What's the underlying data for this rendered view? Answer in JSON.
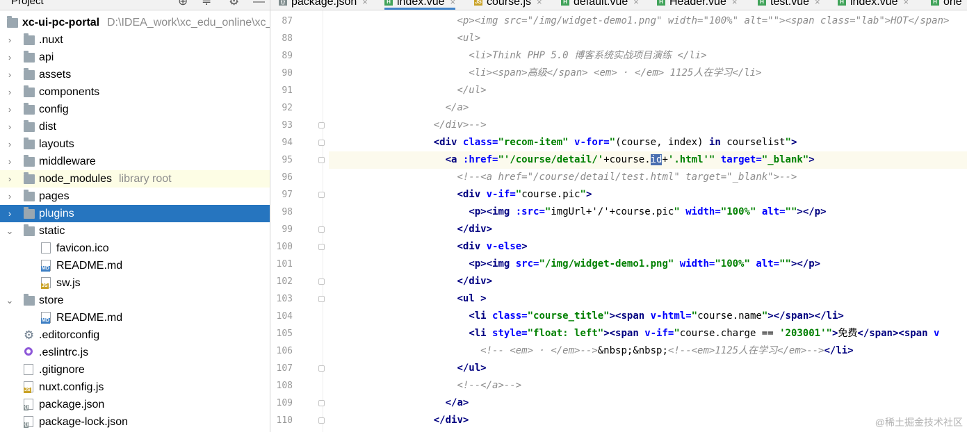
{
  "project_pane": {
    "title": "Project",
    "root": {
      "name": "xc-ui-pc-portal",
      "path": "D:\\IDEA_work\\xc_edu_online\\xc_"
    },
    "items": [
      {
        "name": ".nuxt",
        "type": "folder",
        "level": 1,
        "expanded": false
      },
      {
        "name": "api",
        "type": "folder",
        "level": 1,
        "expanded": false
      },
      {
        "name": "assets",
        "type": "folder",
        "level": 1,
        "expanded": false
      },
      {
        "name": "components",
        "type": "folder",
        "level": 1,
        "expanded": false
      },
      {
        "name": "config",
        "type": "folder",
        "level": 1,
        "expanded": false
      },
      {
        "name": "dist",
        "type": "folder",
        "level": 1,
        "expanded": false
      },
      {
        "name": "layouts",
        "type": "folder",
        "level": 1,
        "expanded": false
      },
      {
        "name": "middleware",
        "type": "folder",
        "level": 1,
        "expanded": false
      },
      {
        "name": "node_modules",
        "suffix": "library root",
        "type": "folder",
        "level": 1,
        "expanded": false,
        "highlighted": true
      },
      {
        "name": "pages",
        "type": "folder",
        "level": 1,
        "expanded": false
      },
      {
        "name": "plugins",
        "type": "folder",
        "level": 1,
        "expanded": false,
        "selected": true
      },
      {
        "name": "static",
        "type": "folder",
        "level": 1,
        "expanded": true
      },
      {
        "name": "favicon.ico",
        "type": "file",
        "icon": "ico",
        "level": 2
      },
      {
        "name": "README.md",
        "type": "file",
        "icon": "md",
        "level": 2
      },
      {
        "name": "sw.js",
        "type": "file",
        "icon": "js",
        "level": 2
      },
      {
        "name": "store",
        "type": "folder",
        "level": 1,
        "expanded": true
      },
      {
        "name": "README.md",
        "type": "file",
        "icon": "md",
        "level": 2
      },
      {
        "name": ".editorconfig",
        "type": "file",
        "icon": "gear",
        "level": 1
      },
      {
        "name": ".eslintrc.js",
        "type": "file",
        "icon": "eslint",
        "level": 1
      },
      {
        "name": ".gitignore",
        "type": "file",
        "icon": "txt",
        "level": 1
      },
      {
        "name": "nuxt.config.js",
        "type": "file",
        "icon": "js",
        "level": 1
      },
      {
        "name": "package.json",
        "type": "file",
        "icon": "json",
        "level": 1
      },
      {
        "name": "package-lock.json",
        "type": "file",
        "icon": "json",
        "level": 1
      }
    ]
  },
  "tabs": [
    {
      "label": "package.json",
      "icon": "json",
      "active": false
    },
    {
      "label": "index.vue",
      "icon": "vue",
      "active": true
    },
    {
      "label": "course.js",
      "icon": "js",
      "active": false
    },
    {
      "label": "default.vue",
      "icon": "vue",
      "active": false
    },
    {
      "label": "Header.vue",
      "icon": "vue",
      "active": false
    },
    {
      "label": "test.vue",
      "icon": "vue",
      "active": false
    },
    {
      "label": "index.vue",
      "icon": "vue",
      "active": false
    },
    {
      "label": "one",
      "icon": "vue",
      "active": false
    }
  ],
  "editor": {
    "current_line": 95,
    "lines": [
      {
        "n": 87,
        "fold": false,
        "indent": 22,
        "tokens": [
          {
            "t": "cm",
            "v": "<p><img src=\"/img/widget-demo1.png\" width=\"100%\" alt=\"\"><span class=\"lab\">HOT</span>"
          }
        ]
      },
      {
        "n": 88,
        "fold": false,
        "indent": 22,
        "tokens": [
          {
            "t": "cm",
            "v": "<ul>"
          }
        ]
      },
      {
        "n": 89,
        "fold": false,
        "indent": 24,
        "tokens": [
          {
            "t": "cm",
            "v": "<li>Think PHP 5.0 博客系统实战项目演练 </li>"
          }
        ]
      },
      {
        "n": 90,
        "fold": false,
        "indent": 24,
        "tokens": [
          {
            "t": "cm",
            "v": "<li><span>高级</span> <em> · </em> 1125人在学习</li>"
          }
        ]
      },
      {
        "n": 91,
        "fold": false,
        "indent": 22,
        "tokens": [
          {
            "t": "cm",
            "v": "</ul>"
          }
        ]
      },
      {
        "n": 92,
        "fold": false,
        "indent": 20,
        "tokens": [
          {
            "t": "cm",
            "v": "</a>"
          }
        ]
      },
      {
        "n": 93,
        "fold": true,
        "indent": 18,
        "tokens": [
          {
            "t": "cm",
            "v": "</div>-->"
          }
        ]
      },
      {
        "n": 94,
        "fold": true,
        "indent": 18,
        "tokens": [
          {
            "t": "tg",
            "v": "<div "
          },
          {
            "t": "at",
            "v": "class="
          },
          {
            "t": "st",
            "v": "\"recom-item\" "
          },
          {
            "t": "at",
            "v": "v-for="
          },
          {
            "t": "st",
            "v": "\""
          },
          {
            "t": "ex",
            "v": "(course, index) "
          },
          {
            "t": "kw",
            "v": "in"
          },
          {
            "t": "ex",
            "v": " courselist"
          },
          {
            "t": "st",
            "v": "\""
          },
          {
            "t": "tg",
            "v": ">"
          }
        ]
      },
      {
        "n": 95,
        "fold": true,
        "indent": 20,
        "tokens": [
          {
            "t": "tg",
            "v": "<a "
          },
          {
            "t": "at",
            "v": ":href="
          },
          {
            "t": "st",
            "v": "\"'/course/detail/'"
          },
          {
            "t": "ex",
            "v": "+course."
          },
          {
            "t": "sel",
            "v": "id"
          },
          {
            "t": "ex",
            "v": "+"
          },
          {
            "t": "st",
            "v": "'.html'\" "
          },
          {
            "t": "at",
            "v": "target="
          },
          {
            "t": "st",
            "v": "\"_blank\""
          },
          {
            "t": "tg",
            "v": ">"
          }
        ]
      },
      {
        "n": 96,
        "fold": false,
        "indent": 22,
        "tokens": [
          {
            "t": "cm",
            "v": "<!--<a href=\"/course/detail/test.html\" target=\"_blank\">-->"
          }
        ]
      },
      {
        "n": 97,
        "fold": true,
        "indent": 22,
        "tokens": [
          {
            "t": "tg",
            "v": "<div "
          },
          {
            "t": "at",
            "v": "v-if="
          },
          {
            "t": "st",
            "v": "\""
          },
          {
            "t": "ex",
            "v": "course.pic"
          },
          {
            "t": "st",
            "v": "\""
          },
          {
            "t": "tg",
            "v": ">"
          }
        ]
      },
      {
        "n": 98,
        "fold": false,
        "indent": 24,
        "tokens": [
          {
            "t": "tg",
            "v": "<p><img "
          },
          {
            "t": "at",
            "v": ":src="
          },
          {
            "t": "st",
            "v": "\""
          },
          {
            "t": "ex",
            "v": "imgUrl+'/'+course.pic"
          },
          {
            "t": "st",
            "v": "\" "
          },
          {
            "t": "at",
            "v": "width="
          },
          {
            "t": "st",
            "v": "\"100%\" "
          },
          {
            "t": "at",
            "v": "alt="
          },
          {
            "t": "st",
            "v": "\"\""
          },
          {
            "t": "tg",
            "v": "></p>"
          }
        ]
      },
      {
        "n": 99,
        "fold": true,
        "indent": 22,
        "tokens": [
          {
            "t": "tg",
            "v": "</div>"
          }
        ]
      },
      {
        "n": 100,
        "fold": true,
        "indent": 22,
        "tokens": [
          {
            "t": "tg",
            "v": "<div "
          },
          {
            "t": "at",
            "v": "v-else"
          },
          {
            "t": "tg",
            "v": ">"
          }
        ]
      },
      {
        "n": 101,
        "fold": false,
        "indent": 24,
        "tokens": [
          {
            "t": "tg",
            "v": "<p><img "
          },
          {
            "t": "at",
            "v": "src="
          },
          {
            "t": "st",
            "v": "\"/img/widget-demo1.png\" "
          },
          {
            "t": "at",
            "v": "width="
          },
          {
            "t": "st",
            "v": "\"100%\" "
          },
          {
            "t": "at",
            "v": "alt="
          },
          {
            "t": "st",
            "v": "\"\""
          },
          {
            "t": "tg",
            "v": "></p>"
          }
        ]
      },
      {
        "n": 102,
        "fold": true,
        "indent": 22,
        "tokens": [
          {
            "t": "tg",
            "v": "</div>"
          }
        ]
      },
      {
        "n": 103,
        "fold": true,
        "indent": 22,
        "tokens": [
          {
            "t": "tg",
            "v": "<ul >"
          }
        ]
      },
      {
        "n": 104,
        "fold": false,
        "indent": 24,
        "tokens": [
          {
            "t": "tg",
            "v": "<li "
          },
          {
            "t": "at",
            "v": "class="
          },
          {
            "t": "st",
            "v": "\"course_title\""
          },
          {
            "t": "tg",
            "v": "><span "
          },
          {
            "t": "at",
            "v": "v-html="
          },
          {
            "t": "st",
            "v": "\""
          },
          {
            "t": "ex",
            "v": "course.name"
          },
          {
            "t": "st",
            "v": "\""
          },
          {
            "t": "tg",
            "v": "></span></li>"
          }
        ]
      },
      {
        "n": 105,
        "fold": false,
        "indent": 24,
        "tokens": [
          {
            "t": "tg",
            "v": "<li "
          },
          {
            "t": "at",
            "v": "style="
          },
          {
            "t": "st",
            "v": "\"float: left\""
          },
          {
            "t": "tg",
            "v": "><span "
          },
          {
            "t": "at",
            "v": "v-if="
          },
          {
            "t": "st",
            "v": "\""
          },
          {
            "t": "ex",
            "v": "course.charge == "
          },
          {
            "t": "st",
            "v": "'203001'\""
          },
          {
            "t": "tg",
            "v": ">"
          },
          {
            "t": "ex",
            "v": "免费"
          },
          {
            "t": "tg",
            "v": "</span><span "
          },
          {
            "t": "at",
            "v": "v"
          }
        ]
      },
      {
        "n": 106,
        "fold": false,
        "indent": 26,
        "tokens": [
          {
            "t": "cm",
            "v": "<!-- <em> · </em>-->"
          },
          {
            "t": "en",
            "v": "&nbsp;&nbsp;"
          },
          {
            "t": "cm",
            "v": "<!--<em>1125人在学习</em>-->"
          },
          {
            "t": "tg",
            "v": "</li>"
          }
        ]
      },
      {
        "n": 107,
        "fold": true,
        "indent": 22,
        "tokens": [
          {
            "t": "tg",
            "v": "</ul>"
          }
        ]
      },
      {
        "n": 108,
        "fold": false,
        "indent": 22,
        "tokens": [
          {
            "t": "cm",
            "v": "<!--</a>-->"
          }
        ]
      },
      {
        "n": 109,
        "fold": true,
        "indent": 20,
        "tokens": [
          {
            "t": "tg",
            "v": "</a>"
          }
        ]
      },
      {
        "n": 110,
        "fold": true,
        "indent": 18,
        "tokens": [
          {
            "t": "tg",
            "v": "</div>"
          }
        ]
      }
    ]
  },
  "watermark": "@稀土掘金技术社区",
  "colors": {
    "selection": "#2675bf",
    "library_root_highlight": "#fdfde5",
    "current_line": "#fcfaed",
    "tag": "#000080",
    "attribute": "#0000ff",
    "string": "#008000",
    "comment": "#8c8c8c"
  }
}
